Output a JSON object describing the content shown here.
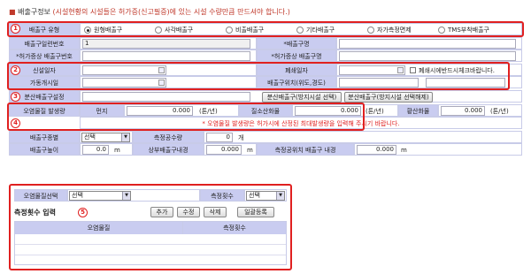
{
  "header": {
    "title": "배출구정보",
    "note": "(시설현황의 시설들은 허가증(신고필증)에 있는 시설 수량만큼 만드셔야 합니다.)"
  },
  "markers": [
    "1",
    "2",
    "3",
    "4",
    "5"
  ],
  "row1": {
    "label": "배출구 유형",
    "options": [
      "원형배출구",
      "사각배출구",
      "비출배출구",
      "기타배출구",
      "자가측정면제",
      "TMS부착배출구"
    ],
    "selected": 0
  },
  "row2": {
    "label_a": "배출구일련번호",
    "value_a": "1",
    "label_b": "*배출구명"
  },
  "row3": {
    "label_a": "*허가증상 배출구번호",
    "label_b": "*허가증상 배출구명"
  },
  "row4": {
    "label_a": "신설일자",
    "label_b": "폐쇄일자",
    "checkbox": "폐쇄시에반드시체크바랍니다."
  },
  "row5": {
    "label_a": "가동개시일",
    "label_b": "배출구위치(위도,경도)"
  },
  "row6": {
    "label": "분산배출구설정",
    "btn_a": "분산배출구(방지시설 선택)",
    "btn_b": "분산배출구(방지시설 선택해제)"
  },
  "row7": {
    "label": "오염물질 발생량",
    "dust": "먼지",
    "dust_val": "0.000",
    "unit": "(톤/년)",
    "nox": "질소산화물",
    "nox_val": "0.000",
    "sox": "황산화물",
    "sox_val": "0.000"
  },
  "row8": {
    "note": "* 오염물질 발생량은 허가시에 산정된 최대발생량을 입력해 주시기 바랍니다."
  },
  "row9": {
    "label": "배출구종별",
    "select": "선택",
    "label_b": "측정공수량",
    "value_b": "0",
    "unit_b": "개"
  },
  "row10": {
    "label": "배출구높이",
    "value": "0.0",
    "unit": "m",
    "label_b": "상부배출구내경",
    "value_b": "0.000",
    "unit_b": "m",
    "label_c": "측정공위치 배출구 내경",
    "value_c": "0.000",
    "unit_c": "m"
  },
  "lower": {
    "pollutant_label": "오염물질선택",
    "pollutant_select": "선택",
    "count_label": "측정횟수",
    "count_select": "선택",
    "section_title": "측정횟수 입력",
    "buttons": [
      "추가",
      "수정",
      "삭제",
      "일괄등록"
    ],
    "columns": [
      "오염물질",
      "측정횟수"
    ]
  }
}
